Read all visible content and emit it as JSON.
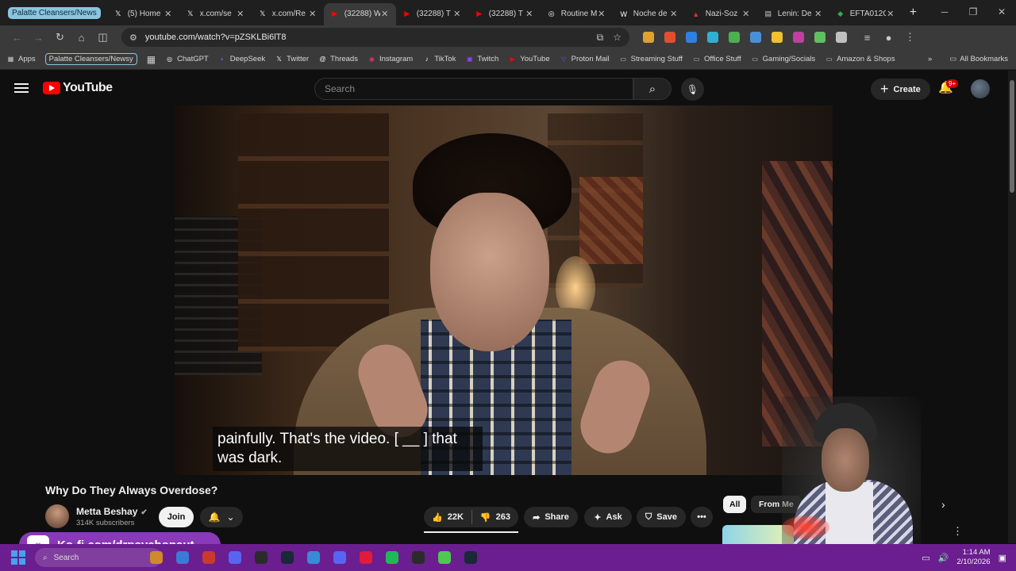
{
  "browser": {
    "tab_group_label": "Palatte Cleansers/News",
    "tabs": [
      {
        "title": "(5) Home",
        "fav": "𝕏",
        "favcolor": "#ffffff",
        "active": false
      },
      {
        "title": "x.com/se",
        "fav": "𝕏",
        "favcolor": "#ffffff",
        "active": false
      },
      {
        "title": "x.com/Re",
        "fav": "𝕏",
        "favcolor": "#ffffff",
        "active": false
      },
      {
        "title": "(32288) W",
        "fav": "▶",
        "favcolor": "#ff0000",
        "active": true
      },
      {
        "title": "(32288) T",
        "fav": "▶",
        "favcolor": "#ff0000",
        "active": false
      },
      {
        "title": "(32288) T",
        "fav": "▶",
        "favcolor": "#ff0000",
        "active": false
      },
      {
        "title": "Routine M",
        "fav": "◎",
        "favcolor": "#ffffff",
        "active": false
      },
      {
        "title": "Noche de",
        "fav": "W",
        "favcolor": "#ffffff",
        "active": false
      },
      {
        "title": "Nazi-Soz",
        "fav": "▲",
        "favcolor": "#e03030",
        "active": false
      },
      {
        "title": "Lenin: De",
        "fav": "▤",
        "favcolor": "#cfcfcf",
        "active": false
      },
      {
        "title": "EFTA012C",
        "fav": "◆",
        "favcolor": "#30b050",
        "active": false
      }
    ],
    "url": "youtube.com/watch?v=pZSKLBi6lT8",
    "extensions": [
      "#e0a030",
      "#e05030",
      "#3080e0",
      "#30b0d0",
      "#4caf50",
      "#4a90d9",
      "#f0c030",
      "#c040a0",
      "#60c060",
      "#c0c0c0"
    ],
    "bookmarks": [
      {
        "label": "ChatGPT",
        "icon": "◎",
        "color": "#ffffff"
      },
      {
        "label": "DeepSeek",
        "icon": "◐",
        "color": "#4d6bfe"
      },
      {
        "label": "Twitter",
        "icon": "𝕏",
        "color": "#ffffff"
      },
      {
        "label": "Threads",
        "icon": "@",
        "color": "#ffffff"
      },
      {
        "label": "Instagram",
        "icon": "◉",
        "color": "#e1306c"
      },
      {
        "label": "TikTok",
        "icon": "♪",
        "color": "#ffffff"
      },
      {
        "label": "Twitch",
        "icon": "▣",
        "color": "#9146ff"
      },
      {
        "label": "YouTube",
        "icon": "▶",
        "color": "#ff0000"
      },
      {
        "label": "Proton Mail",
        "icon": "▽",
        "color": "#6d4aff"
      },
      {
        "label": "Streaming Stuff",
        "icon": "▭",
        "color": "#cfcfcf"
      },
      {
        "label": "Office Stuff",
        "icon": "▭",
        "color": "#cfcfcf"
      },
      {
        "label": "Gaming/Socials",
        "icon": "▭",
        "color": "#cfcfcf"
      },
      {
        "label": "Amazon & Shops",
        "icon": "▭",
        "color": "#cfcfcf"
      }
    ],
    "apps_label": "Apps",
    "bookmark_pill": "Palatte Cleansers/Newsy",
    "all_bookmarks": "All Bookmarks"
  },
  "youtube": {
    "logo_text": "YouTube",
    "search_placeholder": "Search",
    "create_label": "Create",
    "notif_badge": "9+",
    "captions": "painfully. That's the video. [ __ ] that was dark.",
    "video_title": "Why Do They Always Overdose?",
    "channel_name": "Metta Beshay",
    "subscribers": "314K subscribers",
    "join_label": "Join",
    "likes": "22K",
    "dislikes": "263",
    "share_label": "Share",
    "ask_label": "Ask",
    "save_label": "Save",
    "chip_all": "All",
    "chip_from": "From Me"
  },
  "overlay": {
    "kofi_text": "Ko-fi.com/drpsychonaut"
  },
  "taskbar": {
    "search_placeholder": "Search",
    "time": "1:14 AM",
    "date": "2/10/2026",
    "apps": [
      "#d08a2a",
      "#3a7bd5",
      "#c83a30",
      "#5865f2",
      "#2b2b2b",
      "#1b2838",
      "#3a8ad5",
      "#5865f2",
      "#e01b3c",
      "#1db954",
      "#2b2b2b",
      "#4ec94e",
      "#1b2838"
    ]
  }
}
